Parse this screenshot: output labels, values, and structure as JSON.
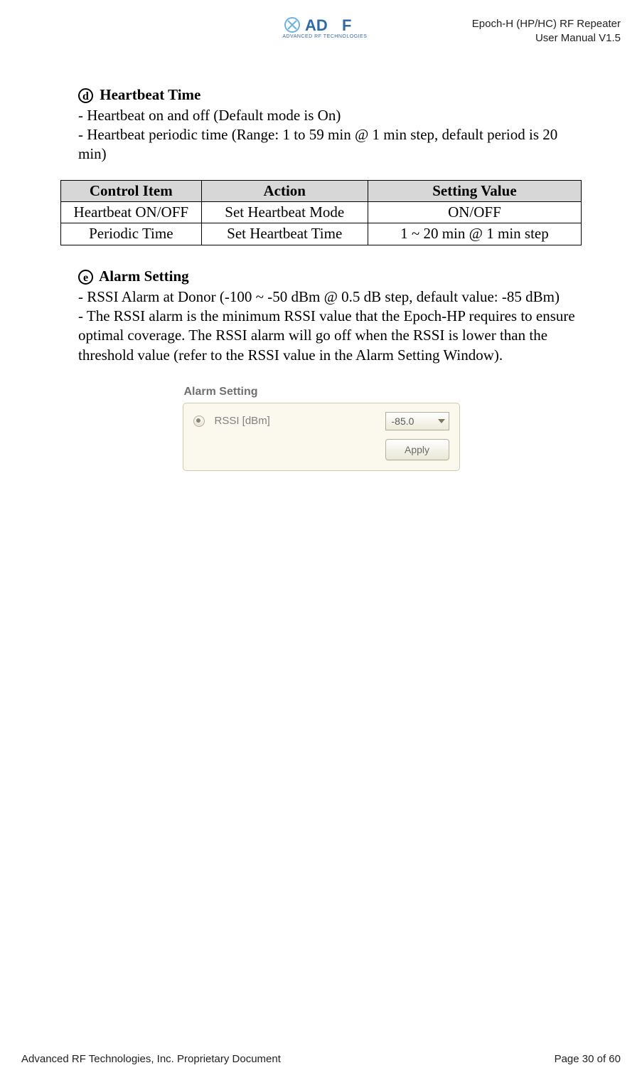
{
  "header": {
    "logo_sub": "ADVANCED RF TECHNOLOGIES",
    "product_line": "Epoch-H (HP/HC) RF Repeater",
    "doc_line": "User Manual V1.5"
  },
  "section_d": {
    "marker": "d",
    "title": "Heartbeat Time",
    "line1": "- Heartbeat on and off (Default mode is On)",
    "line2": "- Heartbeat periodic time (Range: 1 to 59 min @ 1 min step, default period is 20 min)"
  },
  "table": {
    "headers": {
      "c1": "Control Item",
      "c2": "Action",
      "c3": "Setting Value"
    },
    "rows": [
      {
        "c1": "Heartbeat ON/OFF",
        "c2": "Set Heartbeat Mode",
        "c3": "ON/OFF"
      },
      {
        "c1": "Periodic Time",
        "c2": "Set Heartbeat Time",
        "c3": "1 ~ 20 min @ 1 min step"
      }
    ]
  },
  "section_e": {
    "marker": "e",
    "title": "Alarm Setting",
    "line1": "- RSSI Alarm at Donor (-100 ~ -50 dBm @ 0.5 dB step, default value: -85 dBm)",
    "line2": "- The RSSI alarm is the minimum RSSI value that the Epoch-HP requires to ensure optimal coverage.  The RSSI alarm will go off when the RSSI is lower than the threshold value (refer to the RSSI value in the Alarm Setting Window)."
  },
  "alarm_panel": {
    "title": "Alarm Setting",
    "field_label": "RSSI [dBm]",
    "value": "-85.0",
    "apply_label": "Apply"
  },
  "footer": {
    "left": "Advanced RF Technologies, Inc. Proprietary Document",
    "right": "Page 30 of 60"
  }
}
